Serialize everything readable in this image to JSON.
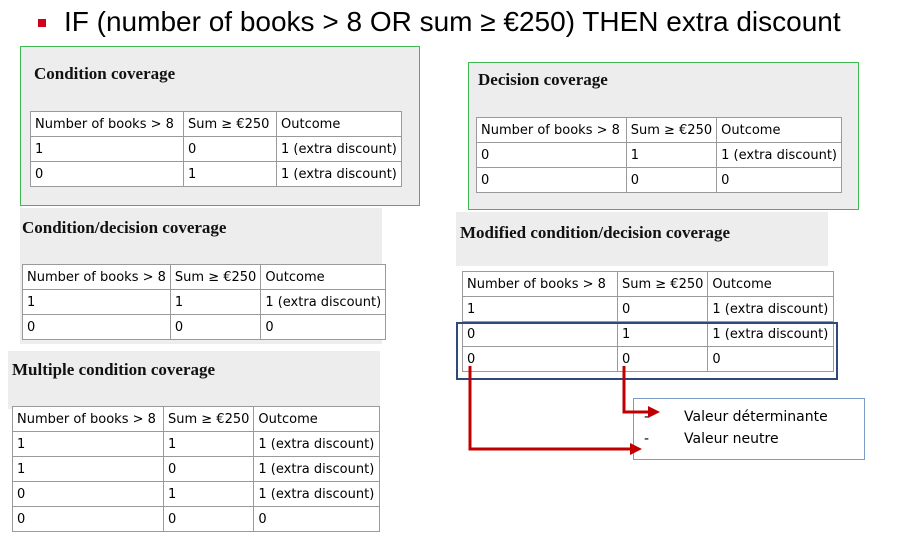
{
  "headline": "IF (number of books > 8 OR sum ≥ €250) THEN extra discount",
  "colors": {
    "bullet": "#d0021b",
    "panel_bg": "#ededed",
    "green_border": "#3fb950",
    "highlight_border": "#2e4a7a",
    "arrow": "#c00000",
    "legend_border": "#7a9cc6"
  },
  "panels": [
    {
      "title": "Condition coverage",
      "headers": [
        "Number of books > 8",
        "Sum ≥ €250",
        "Outcome"
      ],
      "rows": [
        [
          "1",
          "0",
          "1 (extra discount)"
        ],
        [
          "0",
          "1",
          "1 (extra discount)"
        ]
      ]
    },
    {
      "title": "Decision coverage",
      "headers": [
        "Number of books > 8",
        "Sum ≥ €250",
        "Outcome"
      ],
      "rows": [
        [
          "0",
          "1",
          "1 (extra discount)"
        ],
        [
          "0",
          "0",
          "0"
        ]
      ]
    },
    {
      "title": "Condition/decision coverage",
      "headers": [
        "Number of books > 8",
        "Sum ≥ €250",
        "Outcome"
      ],
      "rows": [
        [
          "1",
          "1",
          "1 (extra discount)"
        ],
        [
          "0",
          "0",
          "0"
        ]
      ]
    },
    {
      "title": "Modified condition/decision coverage",
      "headers": [
        "Number of books > 8",
        "Sum ≥ €250",
        "Outcome"
      ],
      "rows": [
        [
          "1",
          "0",
          "1 (extra discount)"
        ],
        [
          "0",
          "1",
          "1 (extra discount)"
        ],
        [
          "0",
          "0",
          "0"
        ]
      ]
    },
    {
      "title": "Multiple condition coverage",
      "headers": [
        "Number of books > 8",
        "Sum ≥ €250",
        "Outcome"
      ],
      "rows": [
        [
          "1",
          "1",
          "1 (extra discount)"
        ],
        [
          "1",
          "0",
          "1 (extra discount)"
        ],
        [
          "0",
          "1",
          "1 (extra discount)"
        ],
        [
          "0",
          "0",
          "0"
        ]
      ]
    }
  ],
  "legend": {
    "items": [
      {
        "dash": "-",
        "text": "Valeur déterminante"
      },
      {
        "dash": "-",
        "text": "Valeur neutre"
      }
    ]
  }
}
